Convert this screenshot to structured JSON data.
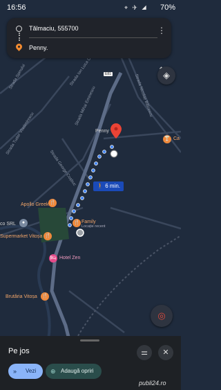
{
  "status_bar": {
    "time": "16:56",
    "battery": "70%",
    "icons": "⌖ ✈ ◢"
  },
  "route": {
    "origin": "Tălmaciu, 555700",
    "destination": "Penny.",
    "menu_icon": "more-vert-icon",
    "swap_icon": "swap-vert-icon"
  },
  "map": {
    "streets": [
      "Strada Spinului",
      "Strada Tudor Vladimirescu",
      "Strada Ion Luca Caragiale",
      "Strada Mihai Eminescu",
      "Strada Nicolae Bălcescu",
      "Strada George Coșbuc"
    ],
    "road_shield": "E81",
    "destination_label": "Penny",
    "pois": [
      "Apollo Greek",
      "Family",
      "Locație recent",
      "Supermarket Vitoșa",
      "Hotel Zen",
      "Brutăria Vitoșa",
      "co SRL",
      "Ca"
    ],
    "walk_time": "6 min.",
    "route_color": "#4285f4"
  },
  "sheet": {
    "title": "Pe jos",
    "view_label": "Vezi",
    "add_stops_label": "Adaugă opriri"
  },
  "watermark": "publi24.ro"
}
